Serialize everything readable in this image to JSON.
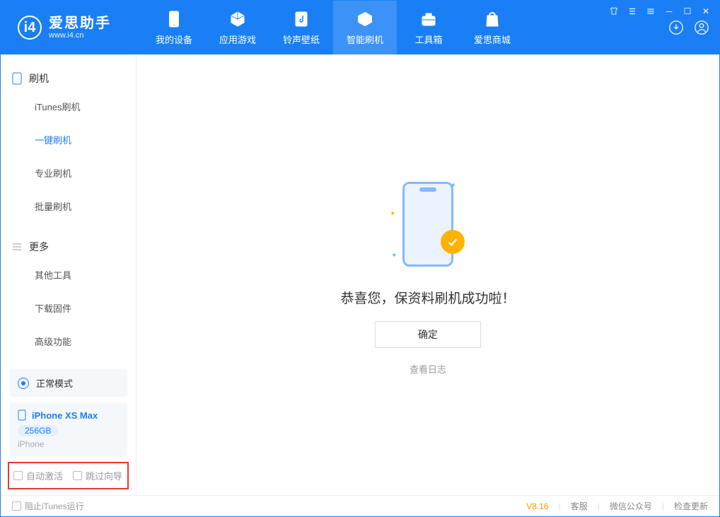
{
  "app": {
    "title": "爱思助手",
    "subtitle": "www.i4.cn"
  },
  "tabs": [
    {
      "label": "我的设备"
    },
    {
      "label": "应用游戏"
    },
    {
      "label": "铃声壁纸"
    },
    {
      "label": "智能刷机"
    },
    {
      "label": "工具箱"
    },
    {
      "label": "爱思商城"
    }
  ],
  "sidebar": {
    "group1": {
      "title": "刷机",
      "items": [
        {
          "label": "iTunes刷机"
        },
        {
          "label": "一键刷机"
        },
        {
          "label": "专业刷机"
        },
        {
          "label": "批量刷机"
        }
      ]
    },
    "group2": {
      "title": "更多",
      "items": [
        {
          "label": "其他工具"
        },
        {
          "label": "下载固件"
        },
        {
          "label": "高级功能"
        }
      ]
    },
    "mode": "正常模式",
    "device": {
      "name": "iPhone XS Max",
      "storage": "256GB",
      "type": "iPhone"
    },
    "checks": {
      "auto_activate": "自动激活",
      "skip_guide": "跳过向导"
    }
  },
  "main": {
    "success_msg": "恭喜您，保资料刷机成功啦！",
    "ok_button": "确定",
    "view_log": "查看日志"
  },
  "footer": {
    "block_itunes": "阻止iTunes运行",
    "version": "V8.16",
    "links": {
      "support": "客服",
      "wechat": "微信公众号",
      "update": "检查更新"
    }
  }
}
